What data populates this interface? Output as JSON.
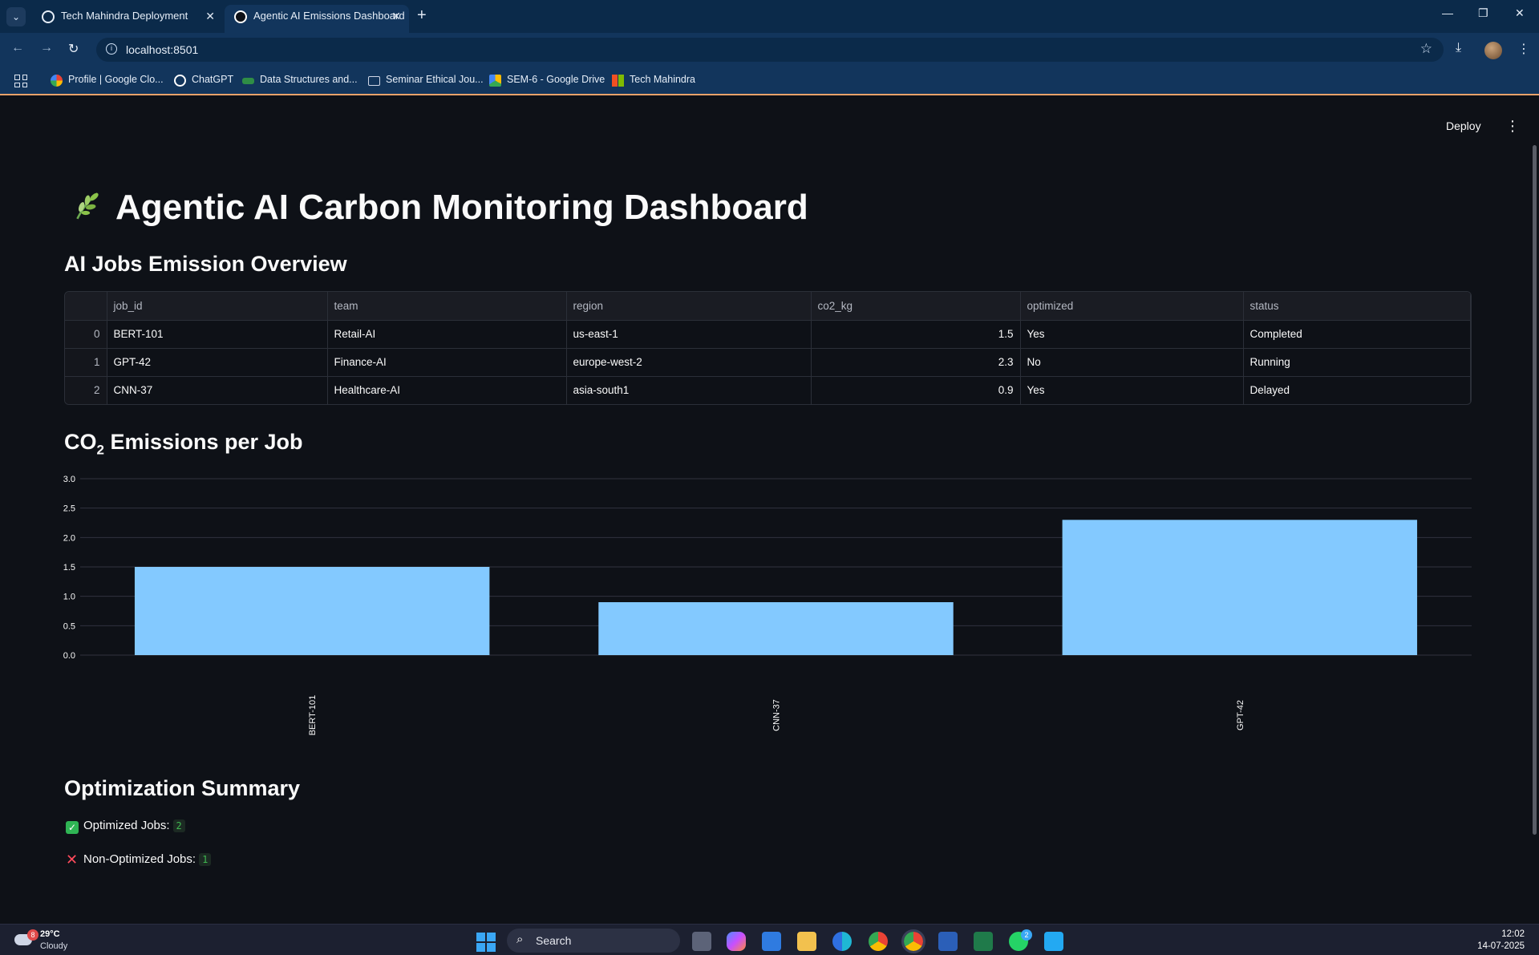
{
  "browser": {
    "tabs": [
      {
        "title": "Tech Mahindra Deployment",
        "active": false
      },
      {
        "title": "Agentic AI Emissions Dashboard",
        "active": true
      }
    ],
    "url": "localhost:8501",
    "bookmarks": [
      {
        "label": "Profile | Google Clo...",
        "icon": "google-cloud-icon",
        "color": "#ea4335"
      },
      {
        "label": "ChatGPT",
        "icon": "chatgpt-icon",
        "color": "#ffffff"
      },
      {
        "label": "Data Structures and...",
        "icon": "gfg-icon",
        "color": "#2f8d46"
      },
      {
        "label": "Seminar Ethical Jou...",
        "icon": "folder-icon",
        "color": "#cfd6e6"
      },
      {
        "label": "SEM-6 - Google Drive",
        "icon": "google-drive-icon",
        "color": "#fbbc04"
      },
      {
        "label": "Tech Mahindra",
        "icon": "microsoft-icon",
        "color": "#f25022"
      }
    ]
  },
  "app": {
    "deploy_label": "Deploy",
    "title": "Agentic AI Carbon Monitoring Dashboard",
    "table_heading": "AI Jobs Emission Overview",
    "table": {
      "columns": [
        "",
        "job_id",
        "team",
        "region",
        "co2_kg",
        "optimized",
        "status"
      ],
      "rows": [
        [
          "0",
          "BERT-101",
          "Retail-AI",
          "us-east-1",
          "1.5",
          "Yes",
          "Completed"
        ],
        [
          "1",
          "GPT-42",
          "Finance-AI",
          "europe-west-2",
          "2.3",
          "No",
          "Running"
        ],
        [
          "2",
          "CNN-37",
          "Healthcare-AI",
          "asia-south1",
          "0.9",
          "Yes",
          "Delayed"
        ]
      ]
    },
    "chart_heading_pre": "CO",
    "chart_heading_sub": "2",
    "chart_heading_post": " Emissions per Job",
    "summary_heading": "Optimization Summary",
    "summary": {
      "optimized_label": "Optimized Jobs:",
      "optimized_count": "2",
      "non_optimized_label": "Non-Optimized Jobs:",
      "non_optimized_count": "1"
    }
  },
  "chart_data": {
    "type": "bar",
    "categories": [
      "BERT-101",
      "CNN-37",
      "GPT-42"
    ],
    "values": [
      1.5,
      0.9,
      2.3
    ],
    "ylim": [
      0,
      3.0
    ],
    "yticks": [
      "0.0",
      "0.5",
      "1.0",
      "1.5",
      "2.0",
      "2.5",
      "3.0"
    ],
    "grid": true,
    "bar_color": "#83c9ff"
  },
  "taskbar": {
    "weather_temp": "29°C",
    "weather_cond": "Cloudy",
    "weather_badge": "8",
    "search_label": "Search",
    "whatsapp_badge": "2",
    "time": "12:02",
    "date": "14-07-2025"
  }
}
